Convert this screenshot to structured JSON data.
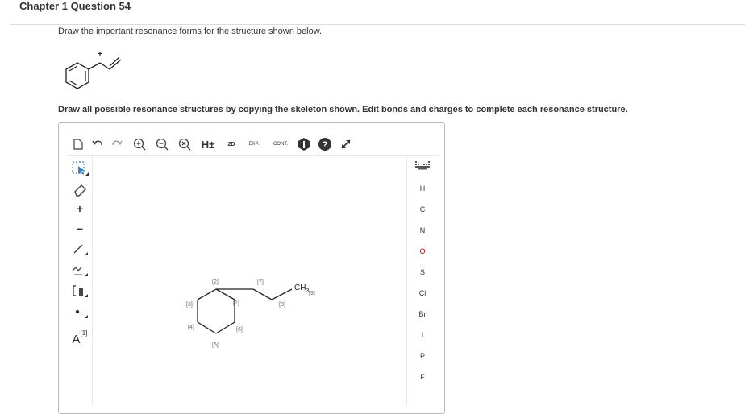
{
  "header": {
    "chapter_title": "Chapter 1 Question 54"
  },
  "question": {
    "text": "Draw the important resonance forms for the structure shown below.",
    "preview_charge": "+",
    "instructions": "Draw all possible resonance structures by copying the skeleton shown. Edit bonds and charges to complete each resonance structure."
  },
  "toolbar": {
    "h_toggle": "H±",
    "twod": "2D",
    "exp": "EXP.",
    "cont": "CONT."
  },
  "left_tools": {
    "plus": "+",
    "minus": "–",
    "atom_label": "A",
    "atom_map": "[1]"
  },
  "elements": [
    "H",
    "C",
    "N",
    "O",
    "S",
    "Cl",
    "Br",
    "I",
    "P",
    "F"
  ],
  "element_colors": {
    "H": "#333333",
    "C": "#333333",
    "N": "#333333",
    "O": "#cc0000",
    "S": "#333333",
    "Cl": "#333333",
    "Br": "#333333",
    "I": "#333333",
    "P": "#333333",
    "F": "#333333"
  },
  "canvas": {
    "ch3_label": "CH",
    "ch3_sub": "3",
    "atom_maps": [
      "[1]",
      "[2]",
      "[3]",
      "[4]",
      "[5]",
      "[6]",
      "[7]",
      "[8]",
      "[9]"
    ]
  }
}
